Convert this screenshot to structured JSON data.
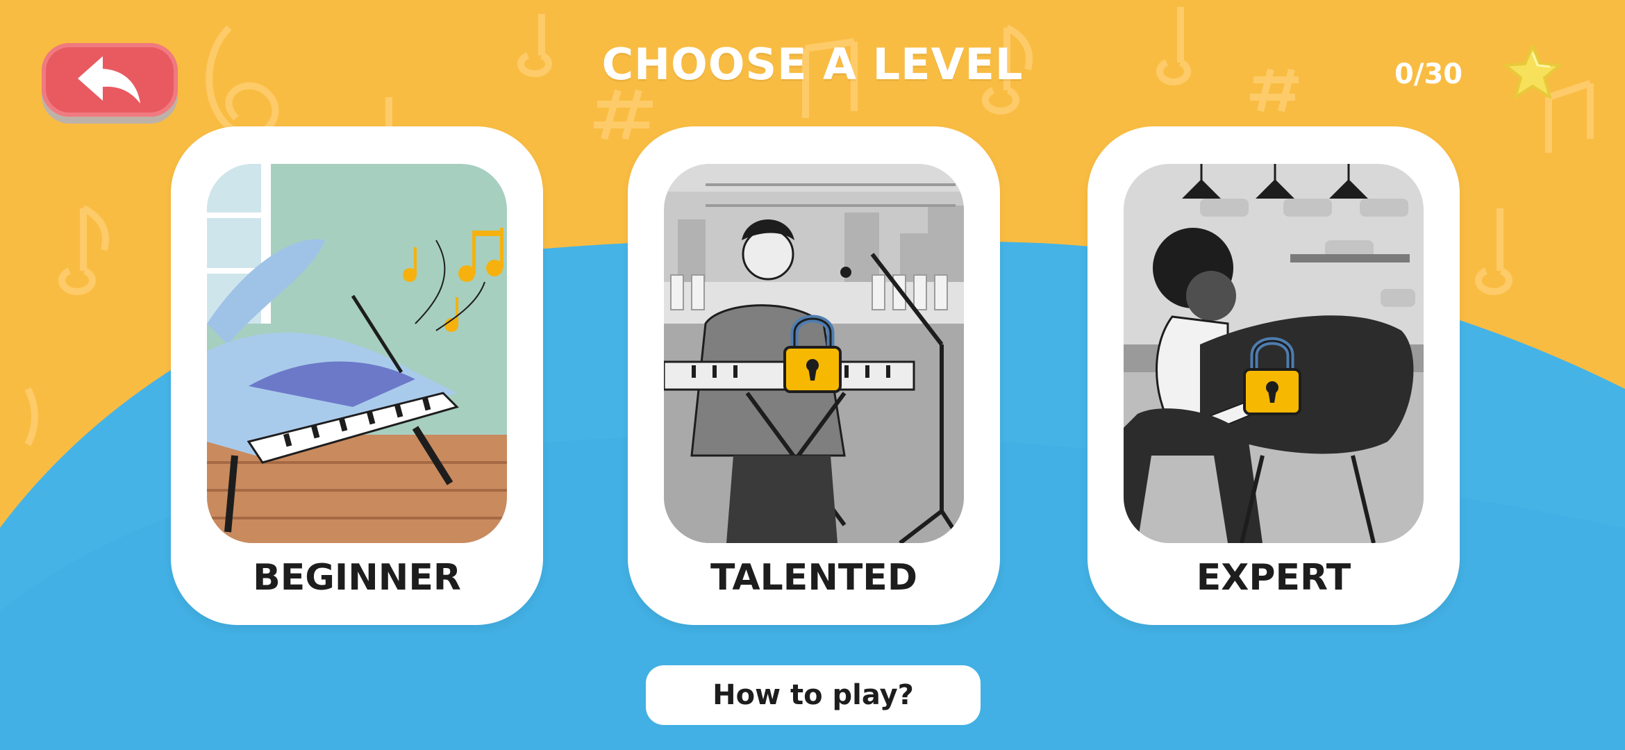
{
  "header": {
    "title": "CHOOSE A LEVEL",
    "score": "0/30",
    "star_icon": "star-icon",
    "back_icon": "back-arrow-icon"
  },
  "levels": [
    {
      "label": "BEGINNER",
      "locked": false,
      "illustration": "grand-piano"
    },
    {
      "label": "TALENTED",
      "locked": true,
      "illustration": "keyboard-player"
    },
    {
      "label": "EXPERT",
      "locked": true,
      "illustration": "pianist"
    }
  ],
  "footer": {
    "how_to_play": "How to play?"
  },
  "colors": {
    "background_yellow": "#F9BC42",
    "background_blue": "#45B3E6",
    "back_button": "#E85A60",
    "lock": "#F6B800"
  }
}
